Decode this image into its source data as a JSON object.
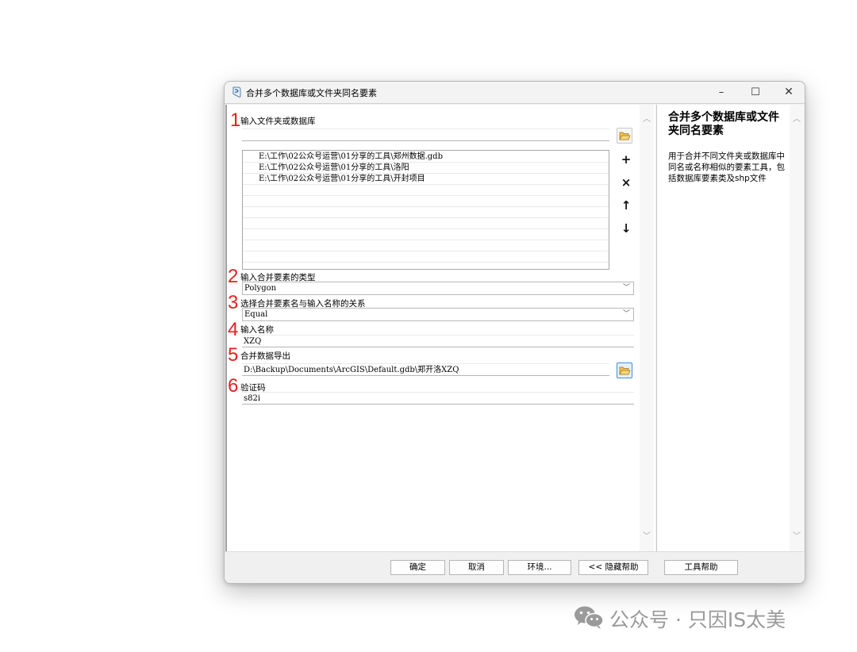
{
  "window": {
    "title": "合并多个数据库或文件夹同名要素",
    "controls": {
      "minimize": "–",
      "maximize": "☐",
      "close": "✕"
    }
  },
  "markers": [
    "1",
    "2",
    "3",
    "4",
    "5",
    "6"
  ],
  "params": {
    "input_folder": {
      "label": "输入文件夹或数据库",
      "value": "",
      "list": [
        "E:\\工作\\02公众号运营\\01分享的工具\\郑州数据.gdb",
        "E:\\工作\\02公众号运营\\01分享的工具\\洛阳",
        "E:\\工作\\02公众号运营\\01分享的工具\\开封项目"
      ]
    },
    "feature_type": {
      "label": "输入合并要素的类型",
      "value": "Polygon"
    },
    "name_relation": {
      "label": "选择合并要素名与输入名称的关系",
      "value": "Equal"
    },
    "input_name": {
      "label": "输入名称",
      "value": "XZQ"
    },
    "output": {
      "label": "合并数据导出",
      "value": "D:\\Backup\\Documents\\ArcGIS\\Default.gdb\\郑开洛XZQ"
    },
    "captcha": {
      "label": "验证码",
      "value": "s82i"
    }
  },
  "list_buttons": {
    "add": "+",
    "remove": "×",
    "up": "↑",
    "down": "↓"
  },
  "help": {
    "title": "合并多个数据库或文件夹同名要素",
    "body": "用于合并不同文件夹或数据库中同名或名称相似的要素工具，包括数据库要素类及shp文件"
  },
  "footer": {
    "ok": "确定",
    "cancel": "取消",
    "env": "环境...",
    "hide_help": "<< 隐藏帮助",
    "tool_help": "工具帮助"
  },
  "watermark": {
    "text": "公众号 · 只因IS太美"
  },
  "icons": [
    "arcgis-tool-icon",
    "folder-open-icon",
    "wechat-icon",
    "chevron-down-icon",
    "scroll-up-icon",
    "scroll-down-icon"
  ]
}
